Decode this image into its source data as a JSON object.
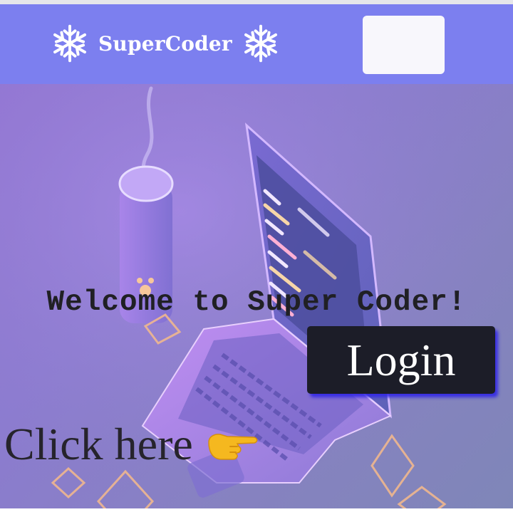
{
  "navbar": {
    "brand_text": "SuperCoder",
    "brand_icon_left": "snowflake-icon",
    "brand_icon_right": "snowflake-icon",
    "menu_box_label": "",
    "background_color": "#7c7fef"
  },
  "hero": {
    "welcome_text": "Welcome to Super Coder!",
    "click_text": "Click here",
    "pointer_icon": "pointing-hand-icon",
    "login_label": "Login",
    "login_color": "#1c1d28",
    "background_art": "laptop-illustration"
  }
}
